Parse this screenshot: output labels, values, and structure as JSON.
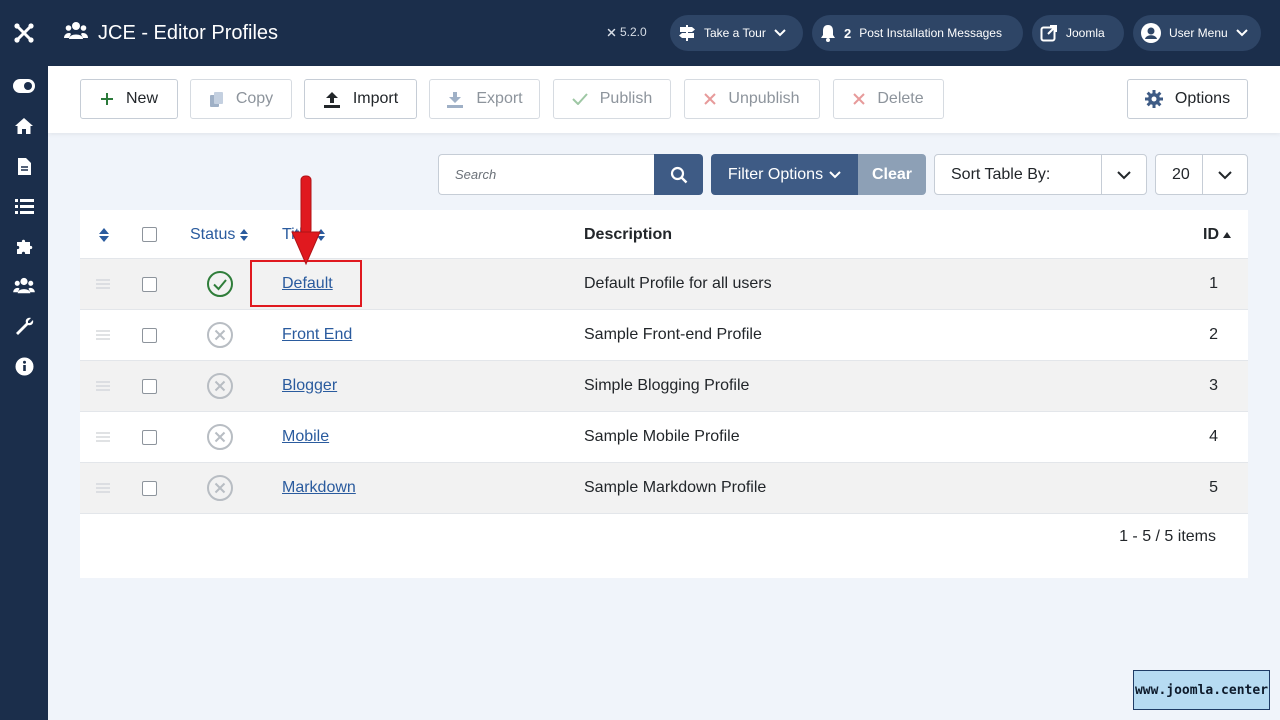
{
  "header": {
    "title": "JCE - Editor Profiles",
    "version": "5.2.0",
    "tour_label": "Take a Tour",
    "messages_count": "2",
    "messages_label": "Post Installation Messages",
    "site_label": "Joomla",
    "user_label": "User Menu"
  },
  "sidebar": {
    "items": [
      "toggle-menu-icon",
      "home-icon",
      "content-icon",
      "menus-icon",
      "components-icon",
      "users-icon",
      "system-icon",
      "help-icon"
    ]
  },
  "toolbar": {
    "new": "New",
    "copy": "Copy",
    "import": "Import",
    "export": "Export",
    "publish": "Publish",
    "unpublish": "Unpublish",
    "delete": "Delete",
    "options": "Options"
  },
  "filters": {
    "search_placeholder": "Search",
    "filter_options": "Filter Options",
    "clear": "Clear",
    "sort_label": "Sort Table By:",
    "limit": "20"
  },
  "table": {
    "columns": {
      "status": "Status",
      "title": "Title",
      "description": "Description",
      "id": "ID"
    },
    "rows": [
      {
        "published": true,
        "title": "Default",
        "description": "Default Profile for all users",
        "id": "1"
      },
      {
        "published": false,
        "title": "Front End",
        "description": "Sample Front-end Profile",
        "id": "2"
      },
      {
        "published": false,
        "title": "Blogger",
        "description": "Simple Blogging Profile",
        "id": "3"
      },
      {
        "published": false,
        "title": "Mobile",
        "description": "Sample Mobile Profile",
        "id": "4"
      },
      {
        "published": false,
        "title": "Markdown",
        "description": "Sample Markdown Profile",
        "id": "5"
      }
    ],
    "pagination": "1 - 5 / 5 items"
  },
  "watermark": "www.joomla.center",
  "colors": {
    "header_bg": "#1b2e4b",
    "accent": "#3e5b85",
    "link": "#2a5b9e",
    "highlight": "#e0191f",
    "published": "#2f7d3a"
  }
}
